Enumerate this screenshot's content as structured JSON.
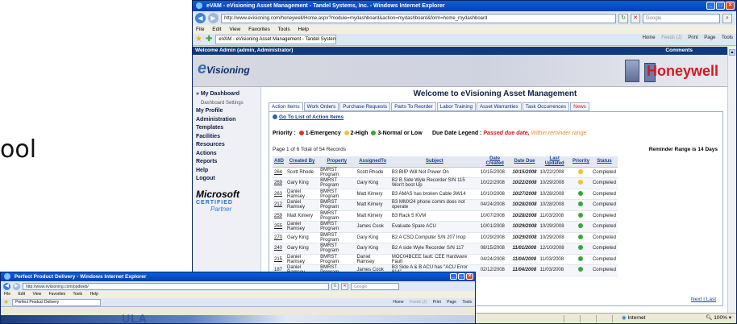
{
  "slide": {
    "partial_text": "ool"
  },
  "main_window": {
    "title": "eVAM - eVisioning Asset Management - Tandel Systems, Inc. - Windows Internet Explorer",
    "url": "http://www.evisioning.com/honeywell/Home.aspx?module=mydashboard&action=mydashboard&form=home_mydashboard",
    "search_placeholder": "Google",
    "menu": [
      "File",
      "Edit",
      "View",
      "Favorites",
      "Tools",
      "Help"
    ],
    "tab_title": "eVAM - eVisioning Asset Management - Tandel System...",
    "command_bar": [
      "Home",
      "Feeds (J)",
      "Print",
      "Page",
      "Tools"
    ],
    "window_buttons": [
      "_",
      "□",
      "×"
    ],
    "status_zone": "Internet",
    "zoom": "100%"
  },
  "app": {
    "welcome_user": "Welcome Admin (admin, Administrator)",
    "comments_link": "Comments",
    "logo_text": "Visioning",
    "logo_initial": "e",
    "brand": "Honeywell",
    "page_title": "Welcome to eVisioning Asset Management",
    "sidebar": {
      "items": [
        {
          "label": "» My Dashboard",
          "sub": false
        },
        {
          "label": "Dashboard Settings",
          "sub": true
        },
        {
          "label": "My Profile",
          "sub": false
        },
        {
          "label": "Administration",
          "sub": false
        },
        {
          "label": "Templates",
          "sub": false
        },
        {
          "label": "Facilities",
          "sub": false
        },
        {
          "label": "Resources",
          "sub": false
        },
        {
          "label": "Actions",
          "sub": false
        },
        {
          "label": "Reports",
          "sub": false
        },
        {
          "label": "Help",
          "sub": false
        },
        {
          "label": "Logout",
          "sub": false
        }
      ],
      "ms_brand": "Microsoft",
      "ms_certified": "CERTIFIED",
      "ms_partner": "Partner"
    },
    "tabs": [
      {
        "label": "Action Items",
        "active": true
      },
      {
        "label": "Work Orders"
      },
      {
        "label": "Purchase Requests"
      },
      {
        "label": "Parts To Reorder"
      },
      {
        "label": "Labor Training"
      },
      {
        "label": "Asset Warranties"
      },
      {
        "label": "Task Occurrences"
      },
      {
        "label": "News",
        "news": true
      }
    ],
    "goto_link": "Go To List of Action Items",
    "priority": {
      "label": "Priority :",
      "p1": "1-Emergency",
      "p2": "2-High",
      "p3": "3-Normal or Low",
      "colors": {
        "p1": "#d9381e",
        "p2": "#f2c230",
        "p3": "#3aa63a"
      }
    },
    "due_legend": {
      "label": "Due Date Legend :",
      "past_due": "Passed due date,",
      "within": "Within reminder range"
    },
    "page_info": "Page 1 of 6 Total of 54 Records",
    "reminder": "Reminder Range is 14 Days",
    "columns": [
      "AIID",
      "Created By",
      "Property",
      "AssignedTo",
      "Subject",
      "Date Created",
      "Date Due",
      "Last Updated",
      "Priority",
      "Status"
    ],
    "rows": [
      {
        "id": "264",
        "created_by": "Scott Rhode",
        "property": "BMRST Program",
        "assigned": "Scott Rhode",
        "subject": "B3 BIIP Will Not Power On",
        "created": "10/15/2008",
        "due": "10/15/2008",
        "updated": "10/22/2008",
        "priority": "p2",
        "status": "Completed"
      },
      {
        "id": "269",
        "created_by": "Gary King",
        "property": "BMRST Program",
        "assigned": "Gary King",
        "subject": "B2 B Side Wyle Recorder S/N 115 Won't boot Up",
        "created": "10/22/2008",
        "due": "10/22/2008",
        "updated": "10/29/2008",
        "priority": "p2",
        "status": "Completed"
      },
      {
        "id": "263",
        "created_by": "Daniel Ramsey",
        "property": "BMRST Program",
        "assigned": "Matt Kimery",
        "subject": "B3 AMAS has broken Cable 3W14",
        "created": "10/10/2008",
        "due": "10/27/2008",
        "updated": "10/28/2008",
        "priority": "p3",
        "status": "Completed"
      },
      {
        "id": "212",
        "created_by": "Daniel Ramsey",
        "property": "BMRST Program",
        "assigned": "Matt Kimery",
        "subject": "B3 MMX24 phone comm does not operate",
        "created": "04/24/2008",
        "due": "10/28/2008",
        "updated": "10/28/2008",
        "priority": "p3",
        "status": "Completed"
      },
      {
        "id": "259",
        "created_by": "Matt Kimery",
        "property": "BMRST Program",
        "assigned": "Matt Kimery",
        "subject": "B3 Rack 5 KVM",
        "created": "10/07/2008",
        "due": "10/28/2008",
        "updated": "11/03/2008",
        "priority": "p3",
        "status": "Completed"
      },
      {
        "id": "255",
        "created_by": "Daniel Ramsey",
        "property": "BMRST Program",
        "assigned": "James Cook",
        "subject": "Evaluate Spare ACU",
        "created": "10/01/2008",
        "due": "10/29/2008",
        "updated": "10/29/2008",
        "priority": "p3",
        "status": "Completed"
      },
      {
        "id": "270",
        "created_by": "Gary King",
        "property": "BMRST Program",
        "assigned": "Gary King",
        "subject": "B2 A CSO Computer S/N 207 Inop",
        "created": "10/29/2008",
        "due": "10/29/2008",
        "updated": "10/29/2008",
        "priority": "p3",
        "status": "Completed"
      },
      {
        "id": "240",
        "created_by": "Gary King",
        "property": "BMRST Program",
        "assigned": "Gary King",
        "subject": "B2 A side Wyle Recorder S/N 117",
        "created": "08/15/2008",
        "due": "11/01/2008",
        "updated": "12/10/2008",
        "priority": "p3",
        "status": "Completed"
      },
      {
        "id": "215",
        "created_by": "Daniel Ramsey",
        "property": "BMRST Program",
        "assigned": "Daniel Ramsey",
        "subject": "MOC04BCEE fault: CEE Hardware Fault",
        "created": "04/24/2008",
        "due": "11/04/2008",
        "updated": "11/03/2008",
        "priority": "p3",
        "status": "Completed"
      },
      {
        "id": "187",
        "created_by": "Daniel Ramsey",
        "property": "BMRST Program",
        "assigned": "James Cook",
        "subject": "B3 Side A & B ACU has \"ACU Error 814\"",
        "created": "02/12/2008",
        "due": "11/04/2008",
        "updated": "11/03/2008",
        "priority": "p3",
        "status": "Completed"
      }
    ],
    "pager": "Next | Last"
  },
  "second_window": {
    "title": "Perfect Product Delivery - Windows Internet Explorer",
    "url": "http://www.evisioning.com/ppdweb/",
    "search_placeholder": "Google",
    "menu": [
      "File",
      "Edit",
      "View",
      "Favorites",
      "Tools",
      "Help"
    ],
    "tab_title": "Perfect Product Delivery",
    "command_bar": [
      "Home",
      "Feeds (J)",
      "Print",
      "Page",
      "Tools"
    ],
    "logo": "ULA"
  }
}
